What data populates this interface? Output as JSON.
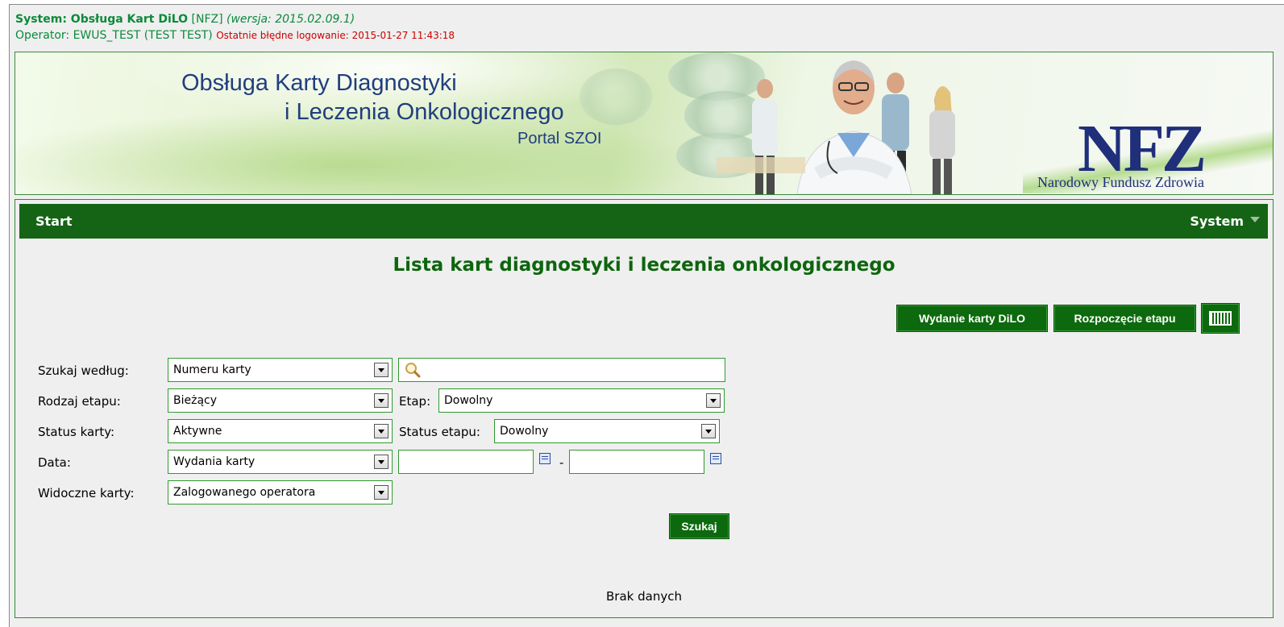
{
  "system": {
    "label": "System: Obsługa Kart DiLO",
    "nfz": "[NFZ]",
    "version": "(wersja: 2015.02.09.1)",
    "operator": "Operator: EWUS_TEST (TEST TEST)",
    "last_failed_login": "Ostatnie błędne logowanie: 2015-01-27 11:43:18"
  },
  "banner": {
    "title_line1": "Obsługa Karty Diagnostyki",
    "title_line2": "i Leczenia Onkologicznego",
    "portal": "Portal SZOI",
    "logo_text": "NFZ",
    "logo_subtitle": "Narodowy Fundusz Zdrowia"
  },
  "menu": {
    "start": "Start",
    "system": "System"
  },
  "page": {
    "title": "Lista kart diagnostyki i leczenia onkologicznego",
    "no_data": "Brak danych"
  },
  "toolbar": {
    "wydanie": "Wydanie karty DiLO",
    "rozpoczecie": "Rozpoczęcie etapu",
    "barcode_icon": "barcode-icon"
  },
  "filters": {
    "search_by_label": "Szukaj według:",
    "search_by_value": "Numeru karty",
    "search_text": "",
    "stage_type_label": "Rodzaj etapu:",
    "stage_type_value": "Bieżący",
    "stage_label": "Etap:",
    "stage_value": "Dowolny",
    "card_status_label": "Status karty:",
    "card_status_value": "Aktywne",
    "stage_status_label": "Status etapu:",
    "stage_status_value": "Dowolny",
    "date_label": "Data:",
    "date_type_value": "Wydania karty",
    "date_from": "",
    "date_to": "",
    "date_separator": "-",
    "visible_label": "Widoczne karty:",
    "visible_value": "Zalogowanego operatora",
    "search_button": "Szukaj"
  },
  "colors": {
    "menu_bar": "#156415",
    "button_green": "#0d690d",
    "title_green": "#0d650d",
    "banner_text": "#203e7e",
    "error_red": "#cc0000"
  }
}
